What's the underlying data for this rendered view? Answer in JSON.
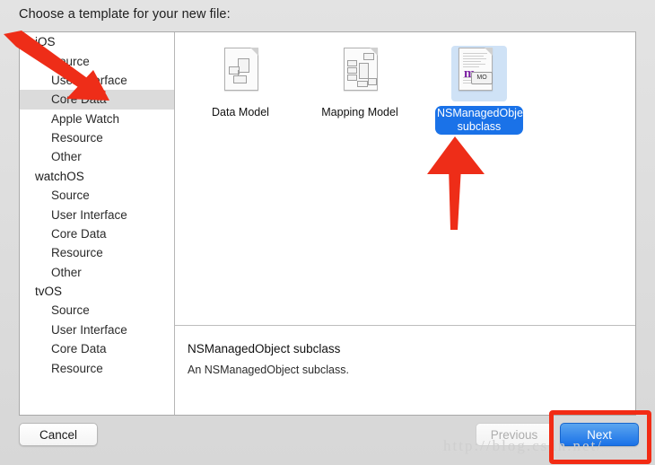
{
  "header": {
    "title": "Choose a template for your new file:"
  },
  "sidebar": {
    "rows": [
      {
        "label": "iOS",
        "type": "group",
        "selected": false
      },
      {
        "label": "Source",
        "type": "item",
        "selected": false
      },
      {
        "label": "User Interface",
        "type": "item",
        "selected": false
      },
      {
        "label": "Core Data",
        "type": "item",
        "selected": true
      },
      {
        "label": "Apple Watch",
        "type": "item",
        "selected": false
      },
      {
        "label": "Resource",
        "type": "item",
        "selected": false
      },
      {
        "label": "Other",
        "type": "item",
        "selected": false
      },
      {
        "label": "watchOS",
        "type": "group",
        "selected": false
      },
      {
        "label": "Source",
        "type": "item",
        "selected": false
      },
      {
        "label": "User Interface",
        "type": "item",
        "selected": false
      },
      {
        "label": "Core Data",
        "type": "item",
        "selected": false
      },
      {
        "label": "Resource",
        "type": "item",
        "selected": false
      },
      {
        "label": "Other",
        "type": "item",
        "selected": false
      },
      {
        "label": "tvOS",
        "type": "group",
        "selected": false
      },
      {
        "label": "Source",
        "type": "item",
        "selected": false
      },
      {
        "label": "User Interface",
        "type": "item",
        "selected": false
      },
      {
        "label": "Core Data",
        "type": "item",
        "selected": false
      },
      {
        "label": "Resource",
        "type": "item",
        "selected": false
      }
    ]
  },
  "templates": [
    {
      "label": "Data Model",
      "icon": "data-model-icon",
      "selected": false
    },
    {
      "label": "Mapping Model",
      "icon": "mapping-model-icon",
      "selected": false
    },
    {
      "label": "NSManagedObject subclass",
      "icon": "nsmanagedobject-icon",
      "selected": true,
      "badge": "MO",
      "glyph": "m"
    }
  ],
  "description": {
    "title": "NSManagedObject subclass",
    "body": "An NSManagedObject subclass."
  },
  "footer": {
    "cancel_label": "Cancel",
    "previous_label": "Previous",
    "next_label": "Next"
  },
  "annotations": {
    "watermark": "http://blog.csdn.net/",
    "arrow_color": "#ee2d18",
    "highlight_color": "#f22b14"
  },
  "colors": {
    "accent": "#1a72e8",
    "selection_tile_bg": "#cfe2f6",
    "sidebar_selection": "#dbdbdb"
  }
}
